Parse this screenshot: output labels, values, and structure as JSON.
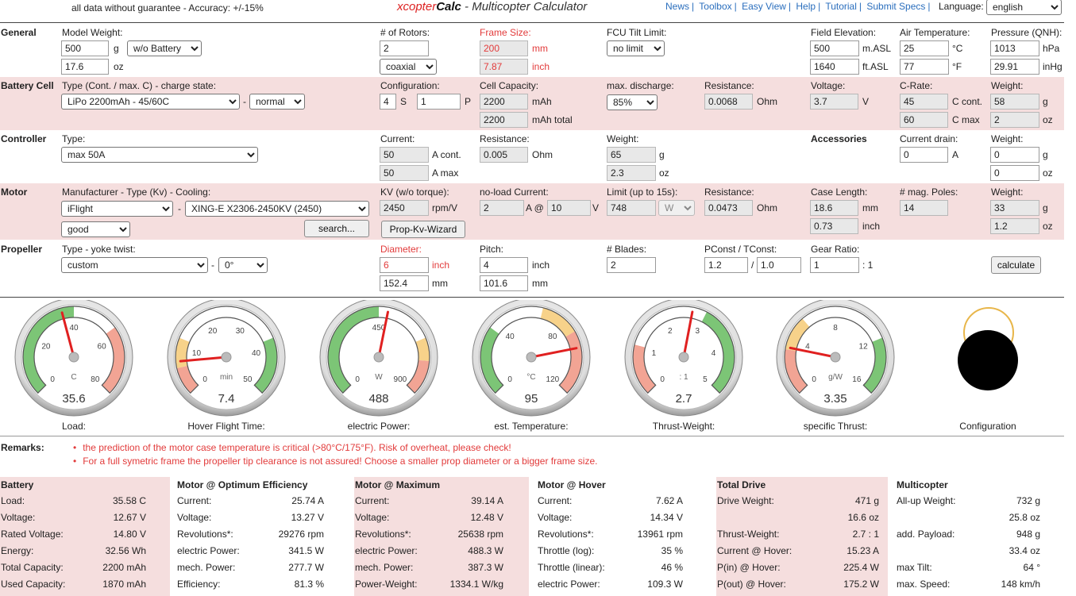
{
  "header": {
    "note": "all data without guarantee - Accuracy: +/-15%",
    "title_x": "xcopter",
    "title_calc": "Calc",
    "title_rest": " - Multicopter Calculator",
    "links": [
      "News",
      "Toolbox",
      "Easy View",
      "Help",
      "Tutorial",
      "Submit Specs"
    ],
    "language_label": "Language:",
    "language_value": "english"
  },
  "general": {
    "section": "General",
    "model_weight_label": "Model Weight:",
    "model_weight_g": "500",
    "model_weight_oz": "17.6",
    "unit_g": "g",
    "unit_oz": "oz",
    "battery_mode": "w/o Battery",
    "rotors_label": "# of Rotors:",
    "rotors": "2",
    "rotor_layout": "coaxial",
    "frame_label": "Frame Size:",
    "frame_mm": "200",
    "frame_inch": "7.87",
    "unit_mm": "mm",
    "unit_inch": "inch",
    "fcu_label": "FCU Tilt Limit:",
    "fcu_value": "no limit",
    "elev_label": "Field Elevation:",
    "elev_m": "500",
    "elev_ft": "1640",
    "unit_masl": "m.ASL",
    "unit_ftasl": "ft.ASL",
    "air_label": "Air Temperature:",
    "air_c": "25",
    "air_f": "77",
    "unit_c": "°C",
    "unit_f": "°F",
    "pressure_label": "Pressure (QNH):",
    "pressure_hpa": "1013",
    "pressure_inhg": "29.91",
    "unit_hpa": "hPa",
    "unit_inhg": "inHg"
  },
  "battery": {
    "section": "Battery Cell",
    "type_label": "Type (Cont. / max. C) - charge state:",
    "type_value": "LiPo 2200mAh - 45/60C",
    "dash": "-",
    "charge_state": "normal",
    "config_label": "Configuration:",
    "series": "4",
    "series_unit": "S",
    "parallel": "1",
    "parallel_unit": "P",
    "capacity_label": "Cell Capacity:",
    "capacity": "2200",
    "capacity_total": "2200",
    "unit_mah": "mAh",
    "unit_mah_total": "mAh total",
    "discharge_label": "max. discharge:",
    "discharge": "85%",
    "resistance_label": "Resistance:",
    "resistance": "0.0068",
    "unit_ohm": "Ohm",
    "voltage_label": "Voltage:",
    "voltage": "3.7",
    "unit_v": "V",
    "crate_label": "C-Rate:",
    "c_cont": "45",
    "c_max": "60",
    "unit_ccont": "C cont.",
    "unit_cmax": "C max",
    "weight_label": "Weight:",
    "weight_g": "58",
    "weight_oz": "2",
    "unit_g": "g",
    "unit_oz": "oz"
  },
  "controller": {
    "section": "Controller",
    "type_label": "Type:",
    "type_value": "max 50A",
    "current_label": "Current:",
    "current_cont": "50",
    "current_max": "50",
    "unit_acont": "A cont.",
    "unit_amax": "A max",
    "resistance_label": "Resistance:",
    "resistance": "0.005",
    "unit_ohm": "Ohm",
    "weight_label": "Weight:",
    "weight_g": "65",
    "weight_oz": "2.3",
    "unit_g": "g",
    "unit_oz": "oz",
    "accessories": "Accessories",
    "drain_label": "Current drain:",
    "drain": "0",
    "unit_a": "A",
    "acc_weight_label": "Weight:",
    "acc_weight_g": "0",
    "acc_weight_oz": "0"
  },
  "motor": {
    "section": "Motor",
    "type_label": "Manufacturer - Type (Kv) - Cooling:",
    "manufacturer": "iFlight",
    "dash": "-",
    "model": "XING-E X2306-2450KV (2450)",
    "cooling": "good",
    "search_button": "search...",
    "kv_label": "KV (w/o torque):",
    "kv": "2450",
    "unit_rpmv": "rpm/V",
    "wizard_button": "Prop-Kv-Wizard",
    "noload_label": "no-load Current:",
    "noload_a": "2",
    "unit_a_at": "A @",
    "noload_v": "10",
    "unit_v": "V",
    "limit_label": "Limit (up to 15s):",
    "limit": "748",
    "limit_unit": "W",
    "resistance_label": "Resistance:",
    "resistance": "0.0473",
    "unit_ohm": "Ohm",
    "case_label": "Case Length:",
    "case_mm": "18.6",
    "case_inch": "0.73",
    "unit_mm": "mm",
    "unit_inch": "inch",
    "poles_label": "# mag. Poles:",
    "poles": "14",
    "weight_label": "Weight:",
    "weight_g": "33",
    "weight_oz": "1.2",
    "unit_g": "g",
    "unit_oz": "oz"
  },
  "propeller": {
    "section": "Propeller",
    "type_label": "Type - yoke twist:",
    "type_value": "custom",
    "dash": "-",
    "twist": "0°",
    "diameter_label": "Diameter:",
    "diameter_inch": "6",
    "diameter_mm": "152.4",
    "unit_inch": "inch",
    "unit_mm": "mm",
    "pitch_label": "Pitch:",
    "pitch_inch": "4",
    "pitch_mm": "101.6",
    "blades_label": "# Blades:",
    "blades": "2",
    "pconst_label": "PConst / TConst:",
    "pconst": "1.2",
    "slash": "/",
    "tconst": "1.0",
    "gear_label": "Gear Ratio:",
    "gear": "1",
    "gear_unit": ": 1",
    "calculate_button": "calculate"
  },
  "gauges": [
    {
      "caption": "Load:",
      "value": "35.6",
      "unit": "C",
      "ticks": [
        "0",
        "20",
        "40",
        "60",
        "80"
      ],
      "min": 0,
      "max": 80,
      "reading": 35.6
    },
    {
      "caption": "Hover Flight Time:",
      "value": "7.4",
      "unit": "min",
      "ticks": [
        "0",
        "10",
        "20",
        "30",
        "40",
        "50"
      ],
      "min": 0,
      "max": 50,
      "reading": 7.4
    },
    {
      "caption": "electric Power:",
      "value": "488",
      "unit": "W",
      "ticks": [
        "0",
        "450",
        "900"
      ],
      "min": 0,
      "max": 900,
      "reading": 488
    },
    {
      "caption": "est. Temperature:",
      "value": "95",
      "unit": "°C",
      "ticks": [
        "0",
        "40",
        "80",
        "120"
      ],
      "min": 0,
      "max": 120,
      "reading": 95
    },
    {
      "caption": "Thrust-Weight:",
      "value": "2.7",
      "unit": ": 1",
      "ticks": [
        "0",
        "1",
        "2",
        "3",
        "4",
        "5"
      ],
      "min": 0,
      "max": 5,
      "reading": 2.7
    },
    {
      "caption": "specific Thrust:",
      "value": "3.35",
      "unit": "g/W",
      "ticks": [
        "0",
        "4",
        "8",
        "12",
        "16"
      ],
      "min": 0,
      "max": 16,
      "reading": 3.35
    }
  ],
  "configuration_caption": "Configuration",
  "remarks": {
    "title": "Remarks:",
    "items": [
      "the prediction of the motor case temperature is critical (>80°C/175°F). Risk of overheat, please check!",
      "For a full symetric frame the propeller tip clearance is not assured! Choose a smaller prop diameter or a bigger frame size."
    ]
  },
  "results": [
    {
      "title": "Battery",
      "rows": [
        {
          "label": "Load:",
          "value": "35.58 C"
        },
        {
          "label": "Voltage:",
          "value": "12.67 V"
        },
        {
          "label": "Rated Voltage:",
          "value": "14.80 V"
        },
        {
          "label": "Energy:",
          "value": "32.56 Wh"
        },
        {
          "label": "Total Capacity:",
          "value": "2200 mAh"
        },
        {
          "label": "Used Capacity:",
          "value": "1870 mAh"
        }
      ]
    },
    {
      "title": "Motor @ Optimum Efficiency",
      "rows": [
        {
          "label": "Current:",
          "value": "25.74 A"
        },
        {
          "label": "Voltage:",
          "value": "13.27 V"
        },
        {
          "label": "Revolutions*:",
          "value": "29276 rpm"
        },
        {
          "label": "electric Power:",
          "value": "341.5 W"
        },
        {
          "label": "mech. Power:",
          "value": "277.7 W"
        },
        {
          "label": "Efficiency:",
          "value": "81.3 %"
        }
      ]
    },
    {
      "title": "Motor @ Maximum",
      "rows": [
        {
          "label": "Current:",
          "value": "39.14 A"
        },
        {
          "label": "Voltage:",
          "value": "12.48 V"
        },
        {
          "label": "Revolutions*:",
          "value": "25638 rpm"
        },
        {
          "label": "electric Power:",
          "value": "488.3 W"
        },
        {
          "label": "mech. Power:",
          "value": "387.3 W"
        },
        {
          "label": "Power-Weight:",
          "value": "1334.1 W/kg"
        }
      ]
    },
    {
      "title": "Motor @ Hover",
      "rows": [
        {
          "label": "Current:",
          "value": "7.62 A"
        },
        {
          "label": "Voltage:",
          "value": "14.34 V"
        },
        {
          "label": "Revolutions*:",
          "value": "13961 rpm"
        },
        {
          "label": "Throttle (log):",
          "value": "35 %"
        },
        {
          "label": "Throttle (linear):",
          "value": "46 %"
        },
        {
          "label": "electric Power:",
          "value": "109.3 W"
        }
      ]
    },
    {
      "title": "Total Drive",
      "rows": [
        {
          "label": "Drive Weight:",
          "value": "471 g"
        },
        {
          "label": "",
          "value": "16.6 oz"
        },
        {
          "label": "Thrust-Weight:",
          "value": "2.7 : 1"
        },
        {
          "label": "Current @ Hover:",
          "value": "15.23 A"
        },
        {
          "label": "P(in) @ Hover:",
          "value": "225.4 W"
        },
        {
          "label": "P(out) @ Hover:",
          "value": "175.2 W"
        }
      ]
    },
    {
      "title": "Multicopter",
      "rows": [
        {
          "label": "All-up Weight:",
          "value": "732 g"
        },
        {
          "label": "",
          "value": "25.8 oz"
        },
        {
          "label": "add. Payload:",
          "value": "948 g"
        },
        {
          "label": "",
          "value": "33.4 oz"
        },
        {
          "label": "max Tilt:",
          "value": "64 °"
        },
        {
          "label": "max. Speed:",
          "value": "148 km/h"
        }
      ]
    }
  ]
}
